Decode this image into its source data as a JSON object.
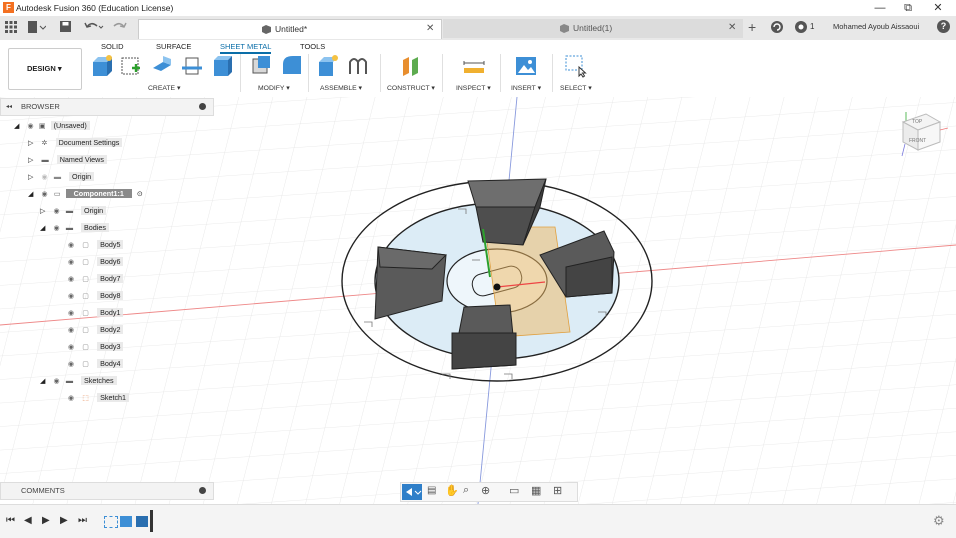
{
  "app": {
    "title": "Autodesk Fusion 360 (Education License)",
    "logo": "F"
  },
  "window_controls": {
    "minimize": "—",
    "restore": "⧉",
    "close": "✕"
  },
  "tabs": [
    {
      "label": "Untitled*",
      "close": "✕"
    },
    {
      "label": "Untitled(1)",
      "close": "✕"
    }
  ],
  "top_right": {
    "notif_count": "1",
    "user": "Mohamed Ayoub Aissaoui",
    "help": "?"
  },
  "ribbon": {
    "tabs": [
      "SOLID",
      "SURFACE",
      "SHEET METAL",
      "TOOLS"
    ],
    "active_tab": "SHEET METAL",
    "workspace": "DESIGN ▾",
    "groups": [
      "CREATE ▾",
      "MODIFY ▾",
      "ASSEMBLE ▾",
      "CONSTRUCT ▾",
      "INSPECT ▾",
      "INSERT ▾",
      "SELECT ▾"
    ]
  },
  "browser": {
    "header": "BROWSER",
    "collapse": "◂◂",
    "items": [
      {
        "label": "(Unsaved)"
      },
      {
        "label": "Document Settings"
      },
      {
        "label": "Named Views"
      },
      {
        "label": "Origin"
      },
      {
        "label": "Component1:1"
      },
      {
        "label": "Origin"
      },
      {
        "label": "Bodies"
      },
      {
        "label": "Body5"
      },
      {
        "label": "Body6"
      },
      {
        "label": "Body7"
      },
      {
        "label": "Body8"
      },
      {
        "label": "Body1"
      },
      {
        "label": "Body2"
      },
      {
        "label": "Body3"
      },
      {
        "label": "Body4"
      },
      {
        "label": "Sketches"
      },
      {
        "label": "Sketch1"
      }
    ]
  },
  "comments": {
    "label": "COMMENTS"
  },
  "viewcube": {
    "top": "TOP",
    "front": "FRONT"
  },
  "colors": {
    "accent": "#0b6ea8",
    "body": "#5a5a5a",
    "plane": "#f0b860",
    "sketch_fill": "#dcecf6"
  }
}
